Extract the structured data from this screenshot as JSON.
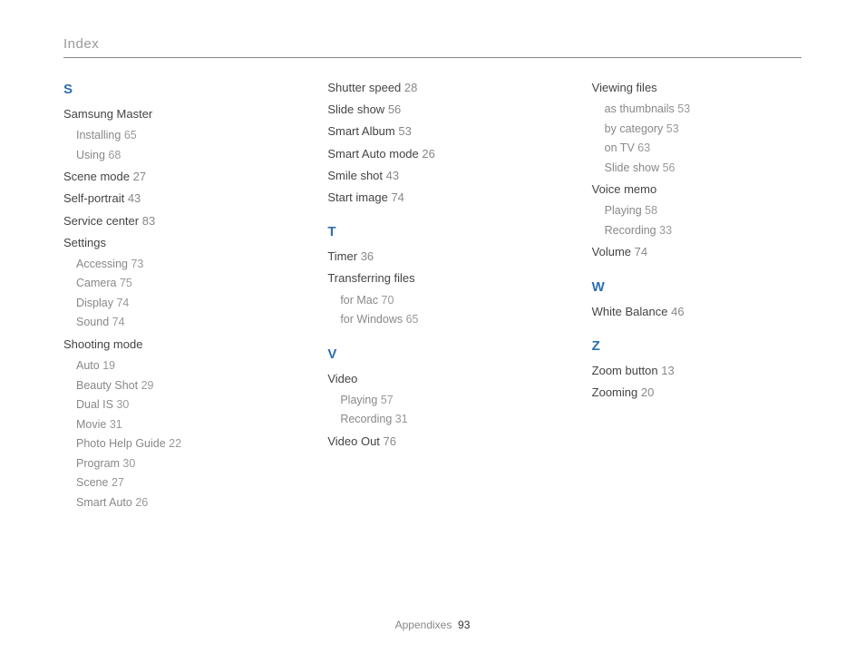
{
  "header": "Index",
  "footer": {
    "section": "Appendixes",
    "page": "93"
  },
  "col1": {
    "letter_s": "S",
    "samsung_master": "Samsung Master",
    "sm_installing": "Installing",
    "sm_installing_pg": "65",
    "sm_using": "Using",
    "sm_using_pg": "68",
    "scene_mode": "Scene mode",
    "scene_mode_pg": "27",
    "self_portrait": "Self-portrait",
    "self_portrait_pg": "43",
    "service_center": "Service center",
    "service_center_pg": "83",
    "settings": "Settings",
    "st_accessing": "Accessing",
    "st_accessing_pg": "73",
    "st_camera": "Camera",
    "st_camera_pg": "75",
    "st_display": "Display",
    "st_display_pg": "74",
    "st_sound": "Sound",
    "st_sound_pg": "74",
    "shooting_mode": "Shooting mode",
    "sh_auto": "Auto",
    "sh_auto_pg": "19",
    "sh_beauty": "Beauty Shot",
    "sh_beauty_pg": "29",
    "sh_dual": "Dual IS",
    "sh_dual_pg": "30",
    "sh_movie": "Movie",
    "sh_movie_pg": "31",
    "sh_help": "Photo Help Guide",
    "sh_help_pg": "22",
    "sh_program": "Program",
    "sh_program_pg": "30",
    "sh_scene": "Scene",
    "sh_scene_pg": "27",
    "sh_smart": "Smart Auto",
    "sh_smart_pg": "26"
  },
  "col2": {
    "shutter_speed": "Shutter speed",
    "shutter_speed_pg": "28",
    "slide_show": "Slide show",
    "slide_show_pg": "56",
    "smart_album": "Smart Album",
    "smart_album_pg": "53",
    "smart_auto_mode": "Smart Auto mode",
    "smart_auto_mode_pg": "26",
    "smile_shot": "Smile shot",
    "smile_shot_pg": "43",
    "start_image": "Start image",
    "start_image_pg": "74",
    "letter_t": "T",
    "timer": "Timer",
    "timer_pg": "36",
    "transferring": "Transferring files",
    "tf_mac": "for Mac",
    "tf_mac_pg": "70",
    "tf_win": "for Windows",
    "tf_win_pg": "65",
    "letter_v": "V",
    "video": "Video",
    "vd_play": "Playing",
    "vd_play_pg": "57",
    "vd_rec": "Recording",
    "vd_rec_pg": "31",
    "video_out": "Video Out",
    "video_out_pg": "76"
  },
  "col3": {
    "viewing": "Viewing files",
    "vf_thumb": "as thumbnails",
    "vf_thumb_pg": "53",
    "vf_cat": "by category",
    "vf_cat_pg": "53",
    "vf_tv": "on TV",
    "vf_tv_pg": "63",
    "vf_slide": "Slide show",
    "vf_slide_pg": "56",
    "voice_memo": "Voice memo",
    "vm_play": "Playing",
    "vm_play_pg": "58",
    "vm_rec": "Recording",
    "vm_rec_pg": "33",
    "volume": "Volume",
    "volume_pg": "74",
    "letter_w": "W",
    "white_balance": "White Balance",
    "white_balance_pg": "46",
    "letter_z": "Z",
    "zoom_button": "Zoom button",
    "zoom_button_pg": "13",
    "zooming": "Zooming",
    "zooming_pg": "20"
  }
}
